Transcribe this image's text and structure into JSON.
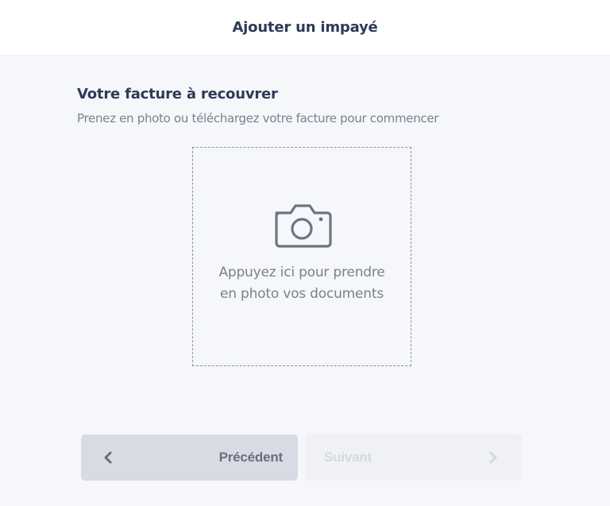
{
  "header": {
    "title": "Ajouter un impayé"
  },
  "section": {
    "title": "Votre facture à recouvrer",
    "subtitle": "Prenez en photo ou téléchargez votre facture pour commencer"
  },
  "dropzone": {
    "icon": "camera-icon",
    "line1": "Appuyez ici pour prendre",
    "line2": "en photo vos documents"
  },
  "navigation": {
    "previous_label": "Précédent",
    "next_label": "Suivant"
  },
  "colors": {
    "heading": "#2f3a58",
    "background": "#f6f7fa",
    "prev_button_bg": "#d7dbe3",
    "next_button_bg": "#eff1f4"
  }
}
